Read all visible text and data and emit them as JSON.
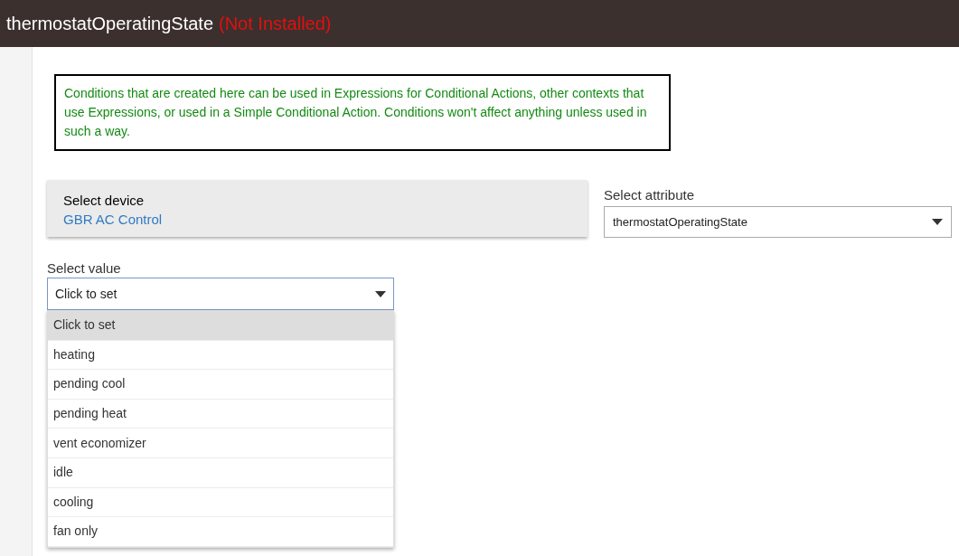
{
  "header": {
    "title": "thermostatOperatingState",
    "status": "(Not Installed)"
  },
  "notice": "Conditions that are created here can be used in Expressions for Conditional Actions, other contexts that use Expressions, or used in a Simple Conditional Action.  Conditions won't affect anything unless used in such a way.",
  "device": {
    "label": "Select device",
    "value": "GBR AC Control"
  },
  "attribute": {
    "label": "Select attribute",
    "value": "thermostatOperatingState"
  },
  "value_select": {
    "label": "Select value",
    "value": "Click to set",
    "expanded": true,
    "options": [
      {
        "label": "Click to set",
        "selected": true
      },
      {
        "label": "heating",
        "selected": false
      },
      {
        "label": "pending cool",
        "selected": false
      },
      {
        "label": "pending heat",
        "selected": false
      },
      {
        "label": "vent economizer",
        "selected": false
      },
      {
        "label": "idle",
        "selected": false
      },
      {
        "label": "cooling",
        "selected": false
      },
      {
        "label": "fan only",
        "selected": false
      }
    ]
  }
}
